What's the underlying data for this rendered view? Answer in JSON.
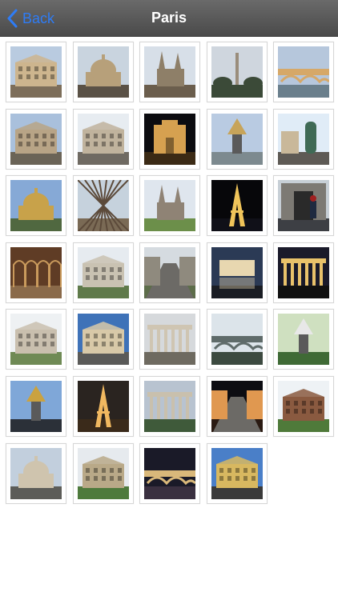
{
  "navbar": {
    "back_label": "Back",
    "back_icon": "chevron-left-icon",
    "title": "Paris"
  },
  "colors": {
    "accent": "#2e7cf6",
    "navbar": "#555555"
  },
  "photos": [
    {
      "subject": "haussmann-building",
      "sky": "#b9cbe0",
      "ground": "#7d6e5a",
      "main": "#cdb58e",
      "kind": "building"
    },
    {
      "subject": "dome-lamppost",
      "sky": "#c9d4df",
      "ground": "#5a5146",
      "main": "#b7a07a",
      "kind": "dome"
    },
    {
      "subject": "church-spire",
      "sky": "#d7dfe8",
      "ground": "#6b5e4d",
      "main": "#8e7f68",
      "kind": "spire"
    },
    {
      "subject": "obelisk-square",
      "sky": "#cfd6de",
      "ground": "#3b4a38",
      "main": "#9a8d7b",
      "kind": "tower"
    },
    {
      "subject": "bridge-river",
      "sky": "#b6c7dc",
      "ground": "#6a7f8c",
      "main": "#d6a868",
      "kind": "bridge"
    },
    {
      "subject": "opera-house",
      "sky": "#a9c0dc",
      "ground": "#6b6457",
      "main": "#b8a486",
      "kind": "building"
    },
    {
      "subject": "apartment-building",
      "sky": "#e7ecf1",
      "ground": "#6f6a62",
      "main": "#c0b39d",
      "kind": "building"
    },
    {
      "subject": "cathedral-night",
      "sky": "#0c0c10",
      "ground": "#3b2a15",
      "main": "#d6a150",
      "kind": "facade"
    },
    {
      "subject": "golden-statue-gate",
      "sky": "#b9cbe2",
      "ground": "#7d8a8f",
      "main": "#c7a45a",
      "kind": "monument"
    },
    {
      "subject": "advertising-column",
      "sky": "#e0ecf7",
      "ground": "#5e5a55",
      "main": "#3f6a55",
      "kind": "column"
    },
    {
      "subject": "invalides-dome",
      "sky": "#86a9d6",
      "ground": "#506840",
      "main": "#c8a24a",
      "kind": "dome"
    },
    {
      "subject": "eiffel-ironwork",
      "sky": "#c6d2dd",
      "ground": "#7a6a55",
      "main": "#5c4a3a",
      "kind": "lattice"
    },
    {
      "subject": "sainte-clotilde",
      "sky": "#dfe6ee",
      "ground": "#6c8f4a",
      "main": "#8f8375",
      "kind": "spire"
    },
    {
      "subject": "eiffel-night",
      "sky": "#07070a",
      "ground": "#101018",
      "main": "#f0c45a",
      "kind": "eiffel"
    },
    {
      "subject": "guard-doorway",
      "sky": "#c7cfd6",
      "ground": "#3d3f44",
      "main": "#1f2a40",
      "kind": "door"
    },
    {
      "subject": "glass-gallery",
      "sky": "#5f3c25",
      "ground": "#8a6a4a",
      "main": "#c99a5c",
      "kind": "arcade"
    },
    {
      "subject": "rodin-museum",
      "sky": "#e6ebf0",
      "ground": "#5f7a4a",
      "main": "#c9c2b2",
      "kind": "building"
    },
    {
      "subject": "avenue-aerial",
      "sky": "#d5dbe0",
      "ground": "#5d6d4a",
      "main": "#8f8a7e",
      "kind": "street"
    },
    {
      "subject": "reflecting-pool",
      "sky": "#2b3a55",
      "ground": "#1a1d24",
      "main": "#e8d7b0",
      "kind": "reflection"
    },
    {
      "subject": "madeleine-lit",
      "sky": "#1a1a2a",
      "ground": "#101010",
      "main": "#e9c26a",
      "kind": "colonnade"
    },
    {
      "subject": "chateau-fountain",
      "sky": "#eef1f3",
      "ground": "#6f8a55",
      "main": "#c9bfae",
      "kind": "building"
    },
    {
      "subject": "lamppost-facade",
      "sky": "#3e72b8",
      "ground": "#5a5a58",
      "main": "#d8c9a8",
      "kind": "building"
    },
    {
      "subject": "columned-facade",
      "sky": "#d6d9dc",
      "ground": "#6e6a60",
      "main": "#cfc5b2",
      "kind": "colonnade"
    },
    {
      "subject": "fountain-bridge",
      "sky": "#dce4ea",
      "ground": "#3c4a40",
      "main": "#5f6b6a",
      "kind": "bridge"
    },
    {
      "subject": "garden-statue",
      "sky": "#cfe0c0",
      "ground": "#3f6a35",
      "main": "#e8e8e8",
      "kind": "monument"
    },
    {
      "subject": "golden-statue",
      "sky": "#7fa7d8",
      "ground": "#2b3038",
      "main": "#caa240",
      "kind": "monument"
    },
    {
      "subject": "eiffel-dusk",
      "sky": "#2a2420",
      "ground": "#3a2a1a",
      "main": "#f0b860",
      "kind": "eiffel"
    },
    {
      "subject": "grand-palais",
      "sky": "#b8c3d0",
      "ground": "#3f5a3a",
      "main": "#c9c0ad",
      "kind": "colonnade"
    },
    {
      "subject": "arc-night",
      "sky": "#0d0d12",
      "ground": "#2a1a12",
      "main": "#e09850",
      "kind": "street"
    },
    {
      "subject": "place-vosges",
      "sky": "#eef2f5",
      "ground": "#4f7a3a",
      "main": "#8a5a40",
      "kind": "building"
    },
    {
      "subject": "petit-palais",
      "sky": "#c2cfdd",
      "ground": "#5c5c58",
      "main": "#cfc4ae",
      "kind": "dome"
    },
    {
      "subject": "park-fountain",
      "sky": "#e6eaee",
      "ground": "#4e7a3c",
      "main": "#b9a988",
      "kind": "building"
    },
    {
      "subject": "seine-night",
      "sky": "#1a1a28",
      "ground": "#3a3040",
      "main": "#d9b87a",
      "kind": "bridge"
    },
    {
      "subject": "louvre-sunset",
      "sky": "#4a7fc8",
      "ground": "#3a3a3a",
      "main": "#d8b860",
      "kind": "building"
    }
  ]
}
